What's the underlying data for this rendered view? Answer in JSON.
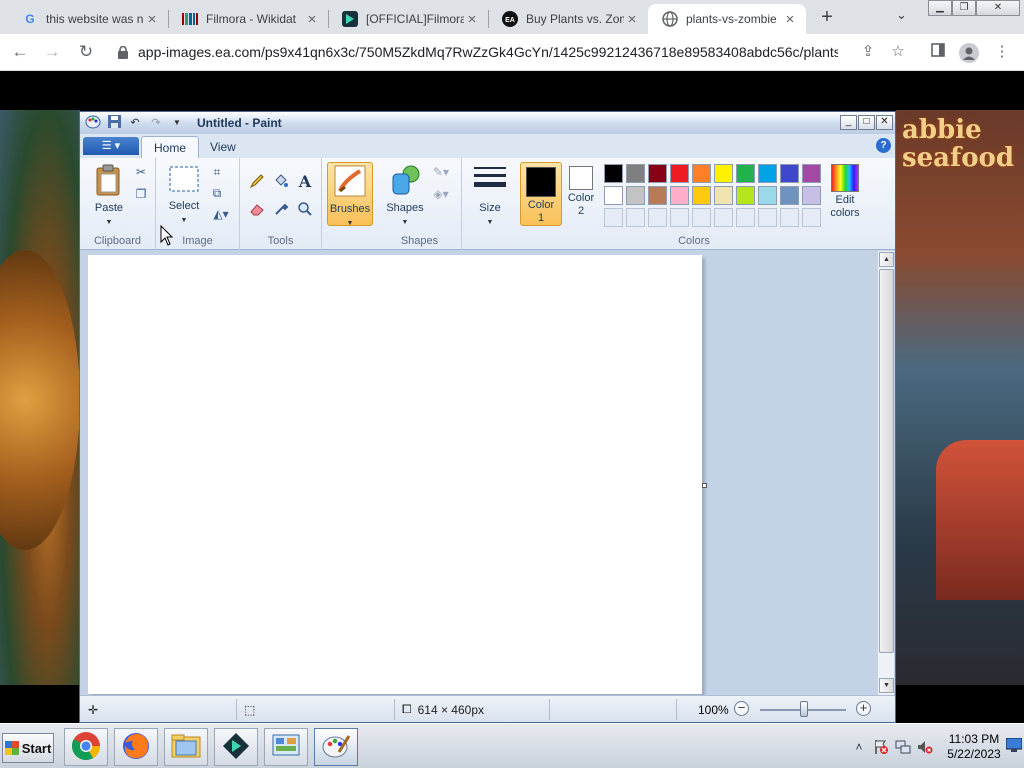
{
  "browser": {
    "tabs": [
      {
        "title": "this website was n",
        "icon": "google-g-icon",
        "active": false
      },
      {
        "title": "Filmora - Wikidat",
        "icon": "wikidata-icon",
        "active": false
      },
      {
        "title": "[OFFICIAL]Filmora",
        "icon": "filmora-icon",
        "active": false
      },
      {
        "title": "Buy Plants vs. Zom",
        "icon": "ea-icon",
        "active": false
      },
      {
        "title": "plants-vs-zombie",
        "icon": "globe-icon",
        "active": true
      }
    ],
    "new_tab": "+",
    "url": "app-images.ea.com/ps9x41qn6x3c/750M5ZkdMq7RwZzGk4GcYn/1425c99212436718e89583408abdc56c/plants-..."
  },
  "background_art": {
    "right_sign": "abbie\nseafood"
  },
  "paint": {
    "title": "Untitled - Paint",
    "tabs": [
      "Home",
      "View"
    ],
    "groups": {
      "clipboard": "Clipboard",
      "image": "Image",
      "tools": "Tools",
      "shapes": "Shapes",
      "colors": "Colors"
    },
    "buttons": {
      "paste": "Paste",
      "select": "Select",
      "brushes": "Brushes",
      "shapes": "Shapes",
      "size": "Size",
      "color1": "Color 1",
      "color2": "Color 2",
      "edit_colors": "Edit colors"
    },
    "current": {
      "color1": "#000000",
      "color2": "#ffffff"
    },
    "palette_row1": [
      "#000000",
      "#7f7f7f",
      "#880015",
      "#ed1c24",
      "#ff7f27",
      "#fff200",
      "#22b14c",
      "#00a2e8",
      "#3f48cc",
      "#a349a4"
    ],
    "palette_row2": [
      "#ffffff",
      "#c3c3c3",
      "#b97a57",
      "#ffaec9",
      "#ffc90e",
      "#efe4b0",
      "#b5e61d",
      "#99d9ea",
      "#7092be",
      "#c8bfe7"
    ],
    "status": {
      "canvas_size": "614 × 460px",
      "zoom": "100%"
    }
  },
  "taskbar": {
    "start": "Start",
    "time": "11:03 PM",
    "date": "5/22/2023"
  }
}
